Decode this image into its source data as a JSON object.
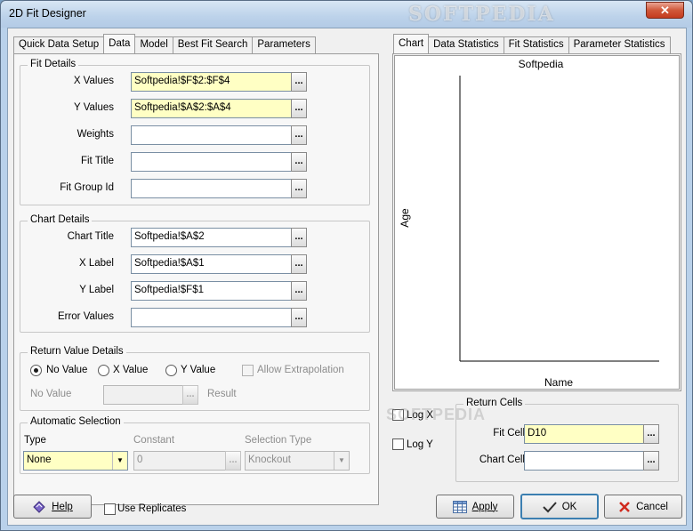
{
  "window": {
    "title": "2D Fit Designer",
    "watermark": "SOFTPEDIA",
    "close_glyph": "✕"
  },
  "left_tabs": [
    {
      "label": "Quick Data Setup"
    },
    {
      "label": "Data"
    },
    {
      "label": "Model"
    },
    {
      "label": "Best Fit Search"
    },
    {
      "label": "Parameters"
    }
  ],
  "fit_details": {
    "title": "Fit Details",
    "x_values": {
      "label": "X Values",
      "value": "Softpedia!$F$2:$F$4"
    },
    "y_values": {
      "label": "Y Values",
      "value": "Softpedia!$A$2:$A$4"
    },
    "weights": {
      "label": "Weights",
      "value": ""
    },
    "fit_title": {
      "label": "Fit Title",
      "value": ""
    },
    "fit_group_id": {
      "label": "Fit Group Id",
      "value": ""
    }
  },
  "chart_details": {
    "title": "Chart Details",
    "chart_title": {
      "label": "Chart Title",
      "value": "Softpedia!$A$2"
    },
    "x_label": {
      "label": "X Label",
      "value": "Softpedia!$A$1"
    },
    "y_label": {
      "label": "Y Label",
      "value": "Softpedia!$F$1"
    },
    "error_values": {
      "label": "Error Values",
      "value": ""
    }
  },
  "return_value_details": {
    "title": "Return Value Details",
    "no_value": "No Value",
    "x_value": "X Value",
    "y_value": "Y Value",
    "allow_extrapolation": "Allow Extrapolation",
    "no_value_label": "No Value",
    "result_label": "Result",
    "no_value_field": ""
  },
  "automatic_selection": {
    "title": "Automatic Selection",
    "type_label": "Type",
    "type_value": "None",
    "constant_label": "Constant",
    "constant_value": "0",
    "selection_type_label": "Selection Type",
    "selection_type_value": "Knockout"
  },
  "right_tabs": [
    {
      "label": "Chart"
    },
    {
      "label": "Data Statistics"
    },
    {
      "label": "Fit Statistics"
    },
    {
      "label": "Parameter Statistics"
    }
  ],
  "chart": {
    "title": "Softpedia",
    "xlabel": "Name",
    "ylabel": "Age"
  },
  "log_x": "Log X",
  "log_y": "Log Y",
  "log_x_watermark": "SOFTPEDIA",
  "return_cells": {
    "title": "Return Cells",
    "fit_cell": {
      "label": "Fit Cell",
      "value": "D10"
    },
    "chart_cell": {
      "label": "Chart Cell",
      "value": ""
    }
  },
  "footer": {
    "help": "Help",
    "use_replicates": "Use Replicates",
    "apply": "Apply",
    "ok": "OK",
    "cancel": "Cancel"
  },
  "dot_glyph": "..."
}
